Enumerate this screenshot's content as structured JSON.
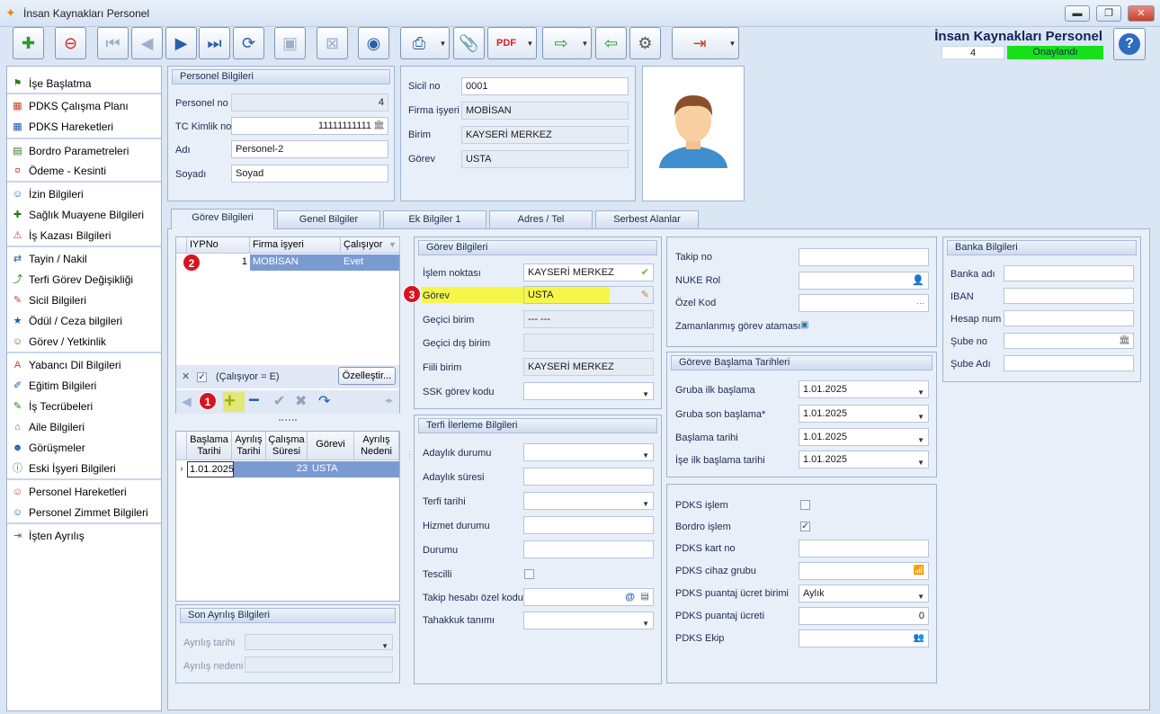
{
  "window": {
    "title": "İnsan Kaynakları Personel",
    "minimize": "▬",
    "maximize": "❐",
    "close": "✕"
  },
  "header": {
    "app_title": "İnsan Kaynakları Personel",
    "record_number": "4",
    "status": "Onaylandı",
    "help": "?"
  },
  "toolbar": {
    "icons": [
      "new-record-icon",
      "delete-record-icon",
      "first-record-icon",
      "previous-record-icon",
      "next-record-icon",
      "last-record-icon",
      "refresh-icon",
      "save-icon",
      "cancel-save-icon",
      "preview-icon",
      "print-icon",
      "attachment-icon",
      "pdf-export-icon",
      "export-icon",
      "import-icon",
      "settings-icon",
      "exit-icon"
    ]
  },
  "sidebar": {
    "items": [
      {
        "label": "İşe Başlatma",
        "icon": "flag-icon"
      },
      {
        "label": "PDKS Çalışma Planı",
        "icon": "calendar-icon"
      },
      {
        "label": "PDKS Hareketleri",
        "icon": "calendar-icon"
      },
      {
        "label": "Bordro Parametreleri",
        "icon": "payroll-icon"
      },
      {
        "label": "Ödeme - Kesinti",
        "icon": "money-icon"
      },
      {
        "label": "İzin Bilgileri",
        "icon": "person-icon"
      },
      {
        "label": "Sağlık Muayene Bilgileri",
        "icon": "health-icon"
      },
      {
        "label": "İş Kazası Bilgileri",
        "icon": "accident-icon"
      },
      {
        "label": "Tayin / Nakil",
        "icon": "transfer-icon"
      },
      {
        "label": "Terfi Görev Değişikliği",
        "icon": "promotion-icon"
      },
      {
        "label": "Sicil Bilgileri",
        "icon": "file-icon"
      },
      {
        "label": "Ödül / Ceza bilgileri",
        "icon": "award-icon"
      },
      {
        "label": "Görev / Yetkinlik",
        "icon": "person-icon"
      },
      {
        "label": "Yabancı Dil Bilgileri",
        "icon": "language-icon"
      },
      {
        "label": "Eğitim Bilgileri",
        "icon": "education-icon"
      },
      {
        "label": "İş Tecrübeleri",
        "icon": "experience-icon"
      },
      {
        "label": "Aile Bilgileri",
        "icon": "family-icon"
      },
      {
        "label": "Görüşmeler",
        "icon": "meeting-icon"
      },
      {
        "label": "Eski İşyeri Bilgileri",
        "icon": "info-icon"
      },
      {
        "label": "Personel Hareketleri",
        "icon": "person-icon"
      },
      {
        "label": "Personel Zimmet Bilgileri",
        "icon": "person-icon"
      },
      {
        "label": "İşten Ayrılış",
        "icon": "exit-person-icon"
      }
    ]
  },
  "personel": {
    "header": "Personel Bilgileri",
    "no_label": "Personel no",
    "no_value": "4",
    "tc_label": "TC Kimlik no",
    "tc_value": "11111111111",
    "adi_label": "Adı",
    "adi_value": "Personel-2",
    "soyadi_label": "Soyadı",
    "soyadi_value": "Soyad"
  },
  "sicil": {
    "sicil_label": "Sicil no",
    "sicil_value": "0001",
    "firma_label": "Firma işyeri",
    "firma_value": "MOBİSAN",
    "birim_label": "Birim",
    "birim_value": "KAYSERİ MERKEZ",
    "gorev_label": "Görev",
    "gorev_value": "USTA"
  },
  "tabs": [
    "Görev Bilgileri",
    "Genel Bilgiler",
    "Ek Bilgiler 1",
    "Adres / Tel",
    "Serbest Alanlar"
  ],
  "iyp_grid": {
    "columns": [
      "IYPNo",
      "Firma işyeri",
      "Çalışıyor"
    ],
    "rows": [
      {
        "iypno": "1",
        "firma": "MOBİSAN",
        "calisiyor": "Evet"
      }
    ],
    "filter_text": "(Çalışıyor = E)",
    "customize": "Özelleştir..."
  },
  "history_grid": {
    "columns": [
      "Başlama Tarihi",
      "Ayrılış Tarihi",
      "Çalışma Süresi",
      "Görevi",
      "Ayrılış Nedeni"
    ],
    "rows": [
      {
        "baslama": "1.01.2025",
        "ayrilis": "",
        "sure": "23",
        "gorevi": "USTA",
        "neden": ""
      }
    ]
  },
  "son_ayrilis": {
    "header": "Son Ayrılış Bilgileri",
    "tarih_label": "Ayrılış tarihi",
    "neden_label": "Ayrılış nedeni"
  },
  "gorev_bilgileri": {
    "header": "Görev Bilgileri",
    "fields": [
      {
        "label": "İşlem noktası",
        "value": "KAYSERİ MERKEZ"
      },
      {
        "label": "Görev",
        "value": "USTA"
      },
      {
        "label": "Geçici birim",
        "value": "--- ---"
      },
      {
        "label": "Geçici dış birim",
        "value": ""
      },
      {
        "label": "Fiili birim",
        "value": "KAYSERİ MERKEZ"
      },
      {
        "label": "SSK görev kodu",
        "value": ""
      }
    ]
  },
  "terfi": {
    "header": "Terfi İlerleme Bilgileri",
    "labels": [
      "Adaylık durumu",
      "Adaylık süresi",
      "Terfi tarihi",
      "Hizmet durumu",
      "Durumu",
      "Tescilli",
      "Takip hesabı özel kodu",
      "Tahakkuk tanımı"
    ]
  },
  "takip": {
    "takip_label": "Takip no",
    "nuke_label": "NUKE Rol",
    "ozel_label": "Özel Kod",
    "zaman_label": "Zamanlanmış görev ataması",
    "ellipsis": "···"
  },
  "baslama": {
    "header": "Göreve Başlama Tarihleri",
    "fields": [
      {
        "label": "Gruba ilk başlama",
        "value": "1.01.2025"
      },
      {
        "label": "Gruba son başlama*",
        "value": "1.01.2025"
      },
      {
        "label": "Başlama tarihi",
        "value": "1.01.2025"
      },
      {
        "label": "İşe ilk başlama tarihi",
        "value": "1.01.2025"
      }
    ]
  },
  "pdks": {
    "islem_label": "PDKS işlem",
    "bordro_label": "Bordro işlem",
    "kart_label": "PDKS kart no",
    "cihaz_label": "PDKS cihaz grubu",
    "birim_label": "PDKS puantaj ücret birimi",
    "birim_value": "Aylık",
    "ucret_label": "PDKS puantaj ücreti",
    "ucret_value": "0",
    "ekip_label": "PDKS Ekip"
  },
  "banka": {
    "header": "Banka Bilgileri",
    "labels": [
      "Banka adı",
      "IBAN",
      "Hesap num",
      "Şube no",
      "Şube Adı"
    ]
  },
  "badges": [
    "1",
    "2",
    "3"
  ],
  "colors": {
    "highlight": "#ffff33",
    "status_green": "#18e01a",
    "selection": "#7a9bd2",
    "badge_red": "#d8141e"
  }
}
